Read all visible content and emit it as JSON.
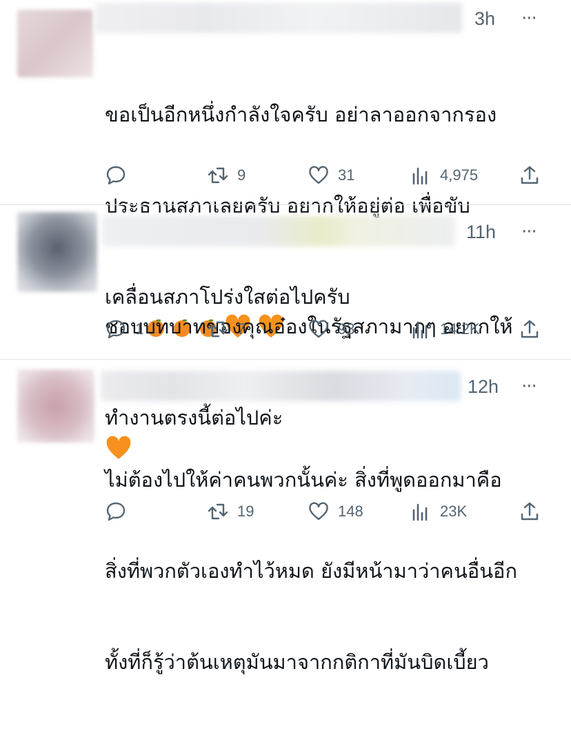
{
  "tweets": [
    {
      "time": "3h",
      "more": "···",
      "lines": [
        "ขอเป็นอีกหนึ่งกำลังใจครับ อย่าลาออกจากรอง",
        "ประธานสภาเลยครับ อยากให้อยู่ต่อ เพื่อขับ",
        "เคลื่อนสภาโปร่งใสต่อไปครับ"
      ],
      "emojis": [
        "tangerine",
        "tangerine",
        "tangerine",
        "orange-heart",
        "orange-heart",
        "orange-heart"
      ],
      "reply": "",
      "retweet": "9",
      "like": "31",
      "views": "4,975"
    },
    {
      "time": "11h",
      "more": "···",
      "lines": [
        "ชอบบทบาทของคุณอ๋องในรัฐสภามากๆ อยากให้",
        "ทำงานตรงนี้ต่อไปค่ะ"
      ],
      "reply": "1",
      "retweet": "7",
      "like": "93",
      "views": "14.2K"
    },
    {
      "time": "12h",
      "more": "···",
      "lines": [
        "ไม่ต้องไปให้ค่าคนพวกนั้นค่ะ สิ่งที่พูดออกมาคือ",
        "สิ่งที่พวกตัวเองทำไว้หมด ยังมีหน้ามาว่าคนอื่นอีก",
        "ทั้งที่ก็รู้ว่าต้นเหตุมันมาจากกติกาที่มันบิดเบี้ยว"
      ],
      "reply": "",
      "retweet": "19",
      "like": "148",
      "views": "23K"
    }
  ],
  "colors": {
    "text": "#0f1419",
    "secondary": "#536471",
    "divider": "#dfe3e6",
    "heart_emoji": "#f7911d",
    "tangerine_emoji": "#f08a24"
  },
  "icons": [
    "reply-icon",
    "retweet-icon",
    "like-icon",
    "views-icon",
    "share-icon"
  ]
}
